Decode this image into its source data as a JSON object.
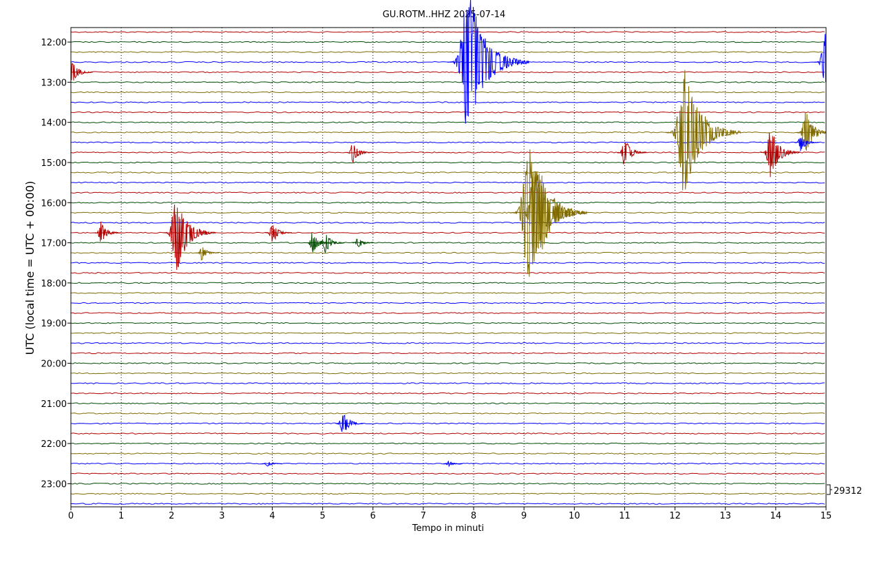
{
  "chart_data": {
    "type": "line",
    "title": "GU.ROTM..HHZ 2025-07-14",
    "xlabel": "Tempo in minuti",
    "ylabel": "UTC (local time = UTC + 00:00)",
    "xlim": [
      0,
      15
    ],
    "x_ticks": [
      "0",
      "1",
      "2",
      "3",
      "4",
      "5",
      "6",
      "7",
      "8",
      "9",
      "10",
      "11",
      "12",
      "13",
      "14",
      "15"
    ],
    "y_tick_labels": [
      "12:00",
      "13:00",
      "14:00",
      "15:00",
      "16:00",
      "17:00",
      "18:00",
      "19:00",
      "20:00",
      "21:00",
      "22:00",
      "23:00"
    ],
    "trace_interval_minutes": 15,
    "first_trace": "11:45",
    "trace_count": 48,
    "trace_colors": [
      "#b20000",
      "#004c00",
      "#7f6a00",
      "#0000ff"
    ],
    "grid": "vertical dotted",
    "scale_label": "29312",
    "events": [
      {
        "trace": 3,
        "minute": 7.9,
        "amplitude": 1.0
      },
      {
        "trace": 3,
        "minute": 15.0,
        "amplitude": 0.45
      },
      {
        "trace": 4,
        "minute": 0.0,
        "amplitude": 0.2
      },
      {
        "trace": 10,
        "minute": 12.2,
        "amplitude": 0.9
      },
      {
        "trace": 10,
        "minute": 14.6,
        "amplitude": 0.3
      },
      {
        "trace": 11,
        "minute": 14.5,
        "amplitude": 0.12
      },
      {
        "trace": 12,
        "minute": 5.6,
        "amplitude": 0.15
      },
      {
        "trace": 12,
        "minute": 11.0,
        "amplitude": 0.2
      },
      {
        "trace": 12,
        "minute": 13.9,
        "amplitude": 0.35
      },
      {
        "trace": 18,
        "minute": 9.1,
        "amplitude": 0.9
      },
      {
        "trace": 18,
        "minute": 9.25,
        "amplitude": 0.8
      },
      {
        "trace": 20,
        "minute": 0.6,
        "amplitude": 0.15
      },
      {
        "trace": 20,
        "minute": 2.1,
        "amplitude": 0.55
      },
      {
        "trace": 20,
        "minute": 4.0,
        "amplitude": 0.15
      },
      {
        "trace": 21,
        "minute": 4.8,
        "amplitude": 0.15
      },
      {
        "trace": 21,
        "minute": 5.05,
        "amplitude": 0.15
      },
      {
        "trace": 21,
        "minute": 5.7,
        "amplitude": 0.08
      },
      {
        "trace": 22,
        "minute": 2.6,
        "amplitude": 0.1
      },
      {
        "trace": 39,
        "minute": 5.4,
        "amplitude": 0.18
      },
      {
        "trace": 43,
        "minute": 3.9,
        "amplitude": 0.05
      },
      {
        "trace": 43,
        "minute": 7.5,
        "amplitude": 0.04
      }
    ]
  }
}
